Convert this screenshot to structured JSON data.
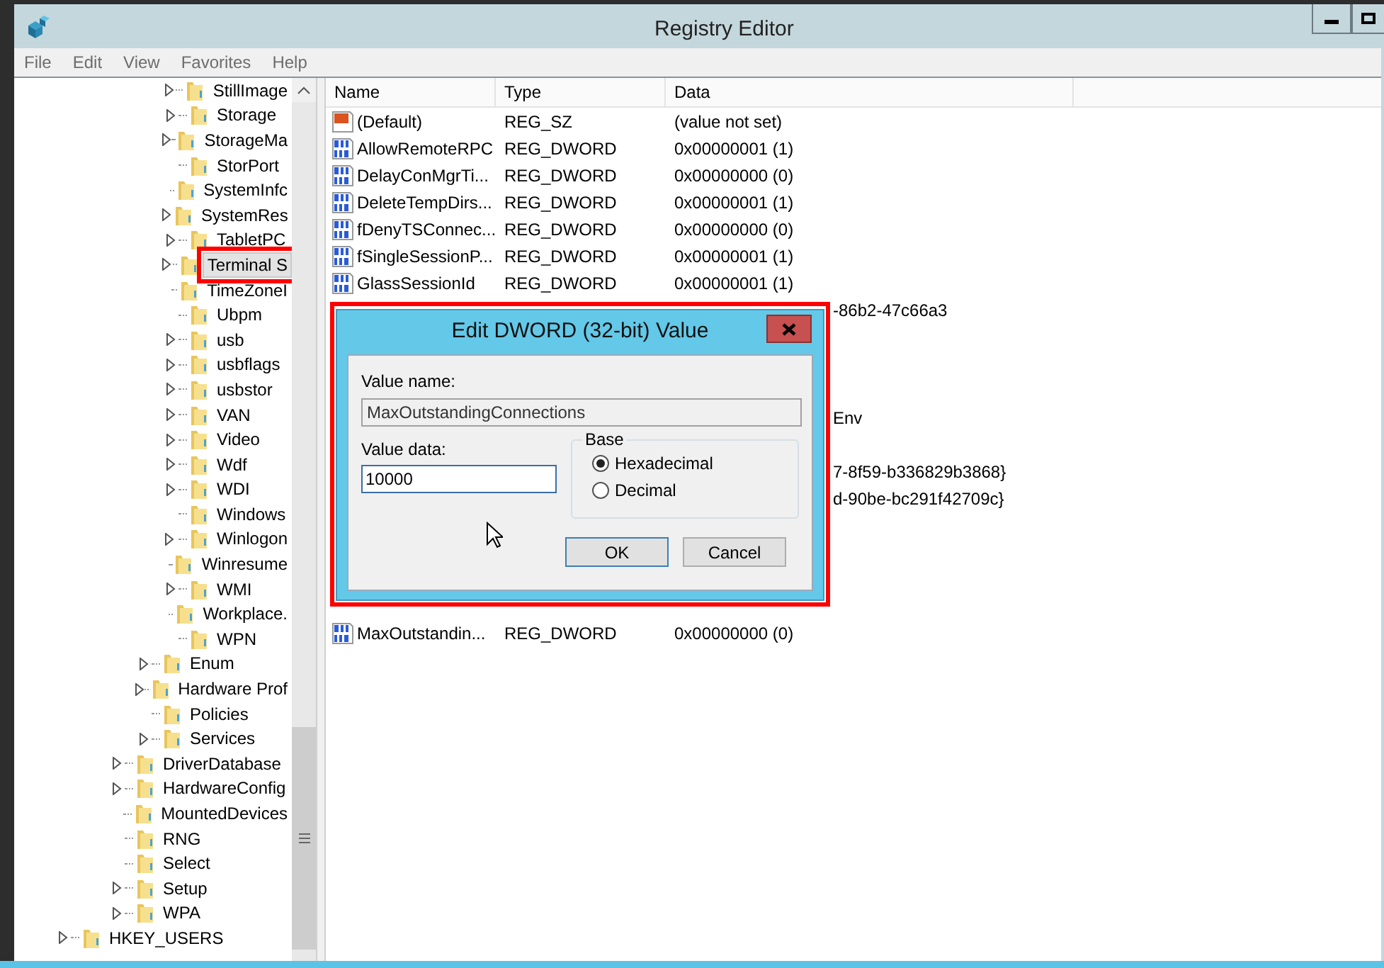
{
  "window": {
    "title": "Registry Editor"
  },
  "menu": [
    "File",
    "Edit",
    "View",
    "Favorites",
    "Help"
  ],
  "tree": [
    {
      "children": [
        {
          "children": [
            {
              "children": [
                {
                  "children": [
                    {
                      "label": "StillImage",
                      "expandable": true,
                      "selected": false,
                      "annotated": false
                    },
                    {
                      "label": "Storage",
                      "expandable": true,
                      "selected": false,
                      "annotated": false
                    },
                    {
                      "label": "StorageMa",
                      "expandable": true,
                      "selected": false,
                      "annotated": false
                    },
                    {
                      "label": "StorPort",
                      "expandable": false,
                      "selected": false,
                      "annotated": false
                    },
                    {
                      "label": "SystemInfc",
                      "expandable": false,
                      "selected": false,
                      "annotated": false
                    },
                    {
                      "label": "SystemRes",
                      "expandable": true,
                      "selected": false,
                      "annotated": false
                    },
                    {
                      "label": "TabletPC",
                      "expandable": true,
                      "selected": false,
                      "annotated": false
                    },
                    {
                      "label": "Terminal S",
                      "expandable": true,
                      "selected": true,
                      "annotated": true
                    },
                    {
                      "label": "TimeZoneI",
                      "expandable": false,
                      "selected": false,
                      "annotated": false
                    },
                    {
                      "label": "Ubpm",
                      "expandable": false,
                      "selected": false,
                      "annotated": false
                    },
                    {
                      "label": "usb",
                      "expandable": true,
                      "selected": false,
                      "annotated": false
                    },
                    {
                      "label": "usbflags",
                      "expandable": true,
                      "selected": false,
                      "annotated": false
                    },
                    {
                      "label": "usbstor",
                      "expandable": true,
                      "selected": false,
                      "annotated": false
                    },
                    {
                      "label": "VAN",
                      "expandable": true,
                      "selected": false,
                      "annotated": false
                    },
                    {
                      "label": "Video",
                      "expandable": true,
                      "selected": false,
                      "annotated": false
                    },
                    {
                      "label": "Wdf",
                      "expandable": true,
                      "selected": false,
                      "annotated": false
                    },
                    {
                      "label": "WDI",
                      "expandable": true,
                      "selected": false,
                      "annotated": false
                    },
                    {
                      "label": "Windows",
                      "expandable": false,
                      "selected": false,
                      "annotated": false
                    },
                    {
                      "label": "Winlogon",
                      "expandable": true,
                      "selected": false,
                      "annotated": false
                    },
                    {
                      "label": "Winresume",
                      "expandable": false,
                      "selected": false,
                      "annotated": false
                    },
                    {
                      "label": "WMI",
                      "expandable": true,
                      "selected": false,
                      "annotated": false
                    },
                    {
                      "label": "Workplace.",
                      "expandable": false,
                      "selected": false,
                      "annotated": false
                    },
                    {
                      "label": "WPN",
                      "expandable": false,
                      "selected": false,
                      "annotated": false
                    }
                  ]
                },
                {
                  "label": "Enum",
                  "expandable": true,
                  "selected": false,
                  "annotated": false
                },
                {
                  "label": "Hardware Prof",
                  "expandable": true,
                  "selected": false,
                  "annotated": false
                },
                {
                  "label": "Policies",
                  "expandable": false,
                  "selected": false,
                  "annotated": false
                },
                {
                  "label": "Services",
                  "expandable": true,
                  "selected": false,
                  "annotated": false
                }
              ]
            },
            {
              "label": "DriverDatabase",
              "expandable": true,
              "selected": false,
              "annotated": false
            },
            {
              "label": "HardwareConfig",
              "expandable": true,
              "selected": false,
              "annotated": false
            },
            {
              "label": "MountedDevices",
              "expandable": false,
              "selected": false,
              "annotated": false
            },
            {
              "label": "RNG",
              "expandable": false,
              "selected": false,
              "annotated": false
            },
            {
              "label": "Select",
              "expandable": false,
              "selected": false,
              "annotated": false
            },
            {
              "label": "Setup",
              "expandable": true,
              "selected": false,
              "annotated": false
            },
            {
              "label": "WPA",
              "expandable": true,
              "selected": false,
              "annotated": false
            }
          ]
        }
      ]
    },
    {
      "label": "HKEY_USERS",
      "expandable": true,
      "selected": false,
      "annotated": false
    }
  ],
  "table": {
    "columns": [
      "Name",
      "Type",
      "Data"
    ],
    "rows": [
      {
        "kind": "string",
        "name": "(Default)",
        "type": "REG_SZ",
        "data": "(value not set)"
      },
      {
        "kind": "dword",
        "name": "AllowRemoteRPC",
        "type": "REG_DWORD",
        "data": "0x00000001 (1)"
      },
      {
        "kind": "dword",
        "name": "DelayConMgrTi...",
        "type": "REG_DWORD",
        "data": "0x00000000 (0)"
      },
      {
        "kind": "dword",
        "name": "DeleteTempDirs...",
        "type": "REG_DWORD",
        "data": "0x00000001 (1)"
      },
      {
        "kind": "dword",
        "name": "fDenyTSConnec...",
        "type": "REG_DWORD",
        "data": "0x00000000 (0)"
      },
      {
        "kind": "dword",
        "name": "fSingleSessionP...",
        "type": "REG_DWORD",
        "data": "0x00000001 (1)"
      },
      {
        "kind": "dword",
        "name": "GlassSessionId",
        "type": "REG_DWORD",
        "data": "0x00000001 (1)"
      },
      {
        "kind": "covered",
        "data": "-86b2-47c66a3"
      },
      {
        "kind": "covered"
      },
      {
        "kind": "covered"
      },
      {
        "kind": "covered"
      },
      {
        "kind": "covered",
        "data": "Env"
      },
      {
        "kind": "covered"
      },
      {
        "kind": "covered",
        "data": "7-8f59-b336829b3868}"
      },
      {
        "kind": "covered",
        "data": "d-90be-bc291f42709c}"
      },
      {
        "kind": "covered"
      },
      {
        "kind": "covered"
      },
      {
        "kind": "covered"
      },
      {
        "kind": "covered"
      },
      {
        "kind": "dword",
        "name": "MaxOutstandin...",
        "type": "REG_DWORD",
        "data": "0x00000000 (0)"
      }
    ]
  },
  "dialog": {
    "title": "Edit DWORD (32-bit) Value",
    "annotated": true,
    "value_name_label": "Value name:",
    "value_name": "MaxOutstandingConnections",
    "value_data_label": "Value data:",
    "value_data": "10000",
    "base": {
      "title": "Base",
      "options": [
        {
          "label": "Hexadecimal",
          "selected": true
        },
        {
          "label": "Decimal",
          "selected": false
        }
      ]
    },
    "buttons": [
      {
        "label": "OK",
        "default": true
      },
      {
        "label": "Cancel",
        "default": false
      }
    ]
  }
}
